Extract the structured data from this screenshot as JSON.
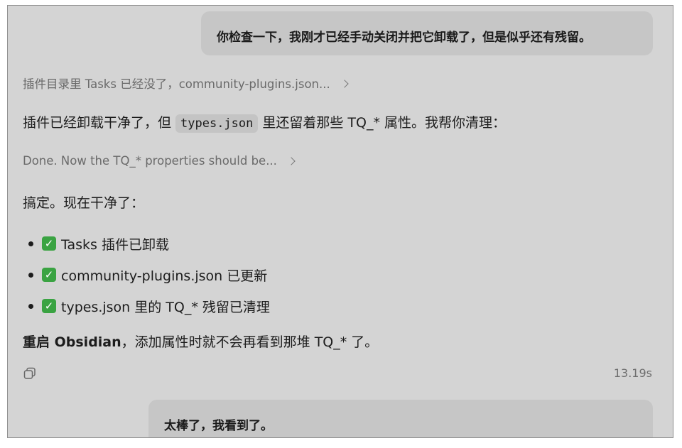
{
  "messages": {
    "user_1": "你检查一下，我刚才已经手动关闭并把它卸载了，但是似乎还有残留。",
    "thought_1": "插件目录里 Tasks 已经没了，community-plugins.json...",
    "reply_1": {
      "before": "插件已经卸载干净了，但",
      "code": "types.json",
      "after": "里还留着那些 TQ_* 属性。我帮你清理："
    },
    "thought_2": "Done. Now the TQ_* properties should be...",
    "reply_2": "搞定。现在干净了：",
    "checklist": [
      "Tasks 插件已卸载",
      "community-plugins.json 已更新",
      "types.json 里的 TQ_* 残留已清理"
    ],
    "reply_3": {
      "bold": "重启 Obsidian",
      "rest": "，添加属性时就不会再看到那堆 TQ_* 了。"
    },
    "elapsed": "13.19s",
    "user_2": "太棒了，我看到了。"
  },
  "icons": {
    "chevron": "chevron-right-icon",
    "check": "check-mark-emoji-icon",
    "copy": "copy-icon"
  },
  "colors": {
    "background": "#d4d4d4",
    "user_bubble": "#c6c6c6",
    "check_green": "#3aa342"
  }
}
